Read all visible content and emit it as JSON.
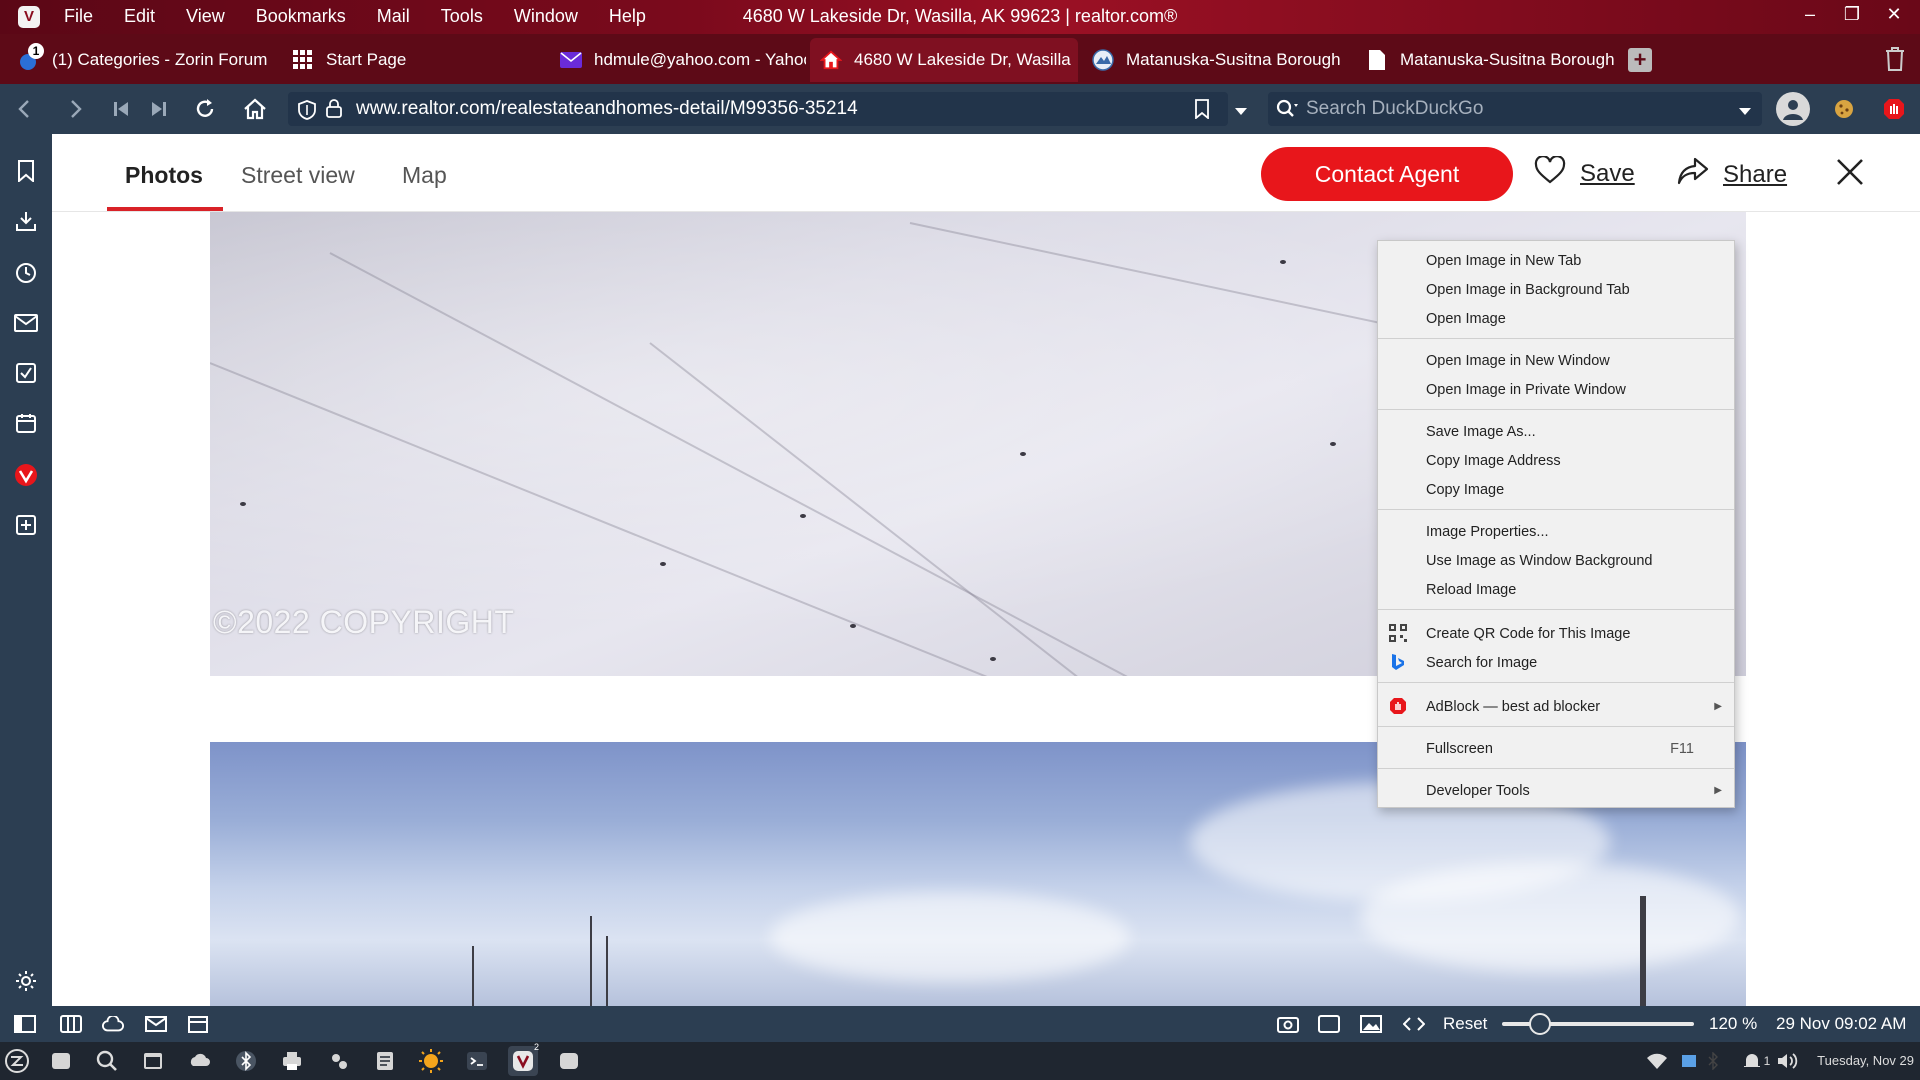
{
  "titlebar": {
    "menu": [
      "File",
      "Edit",
      "View",
      "Bookmarks",
      "Mail",
      "Tools",
      "Window",
      "Help"
    ],
    "window_title": "4680 W Lakeside Dr, Wasilla, AK 99623 | realtor.com®"
  },
  "tabs": [
    {
      "label": "(1) Categories - Zorin Forum",
      "badge": "1",
      "icon": "zorin-forum-icon"
    },
    {
      "label": "Start Page",
      "icon": "grid-icon"
    },
    {
      "label": "hdmule@yahoo.com - Yahoo",
      "icon": "mail-icon"
    },
    {
      "label": "4680 W Lakeside Dr, Wasilla",
      "icon": "realtor-house-icon",
      "active": true
    },
    {
      "label": "Matanuska-Susitna Borough",
      "icon": "borough-seal-icon"
    },
    {
      "label": "Matanuska-Susitna Borough",
      "icon": "document-icon"
    }
  ],
  "addressbar": {
    "url": "www.realtor.com/realestateandhomes-detail/M99356-35214",
    "search_placeholder": "Search DuckDuckGo"
  },
  "page": {
    "tabs": [
      "Photos",
      "Street view",
      "Map"
    ],
    "active_tab": "Photos",
    "contact_label": "Contact Agent",
    "save_label": "Save",
    "share_label": "Share",
    "copyright": "©2022 COPYRIGHT"
  },
  "context_menu": {
    "groups": [
      [
        "Open Image in New Tab",
        "Open Image in Background Tab",
        "Open Image"
      ],
      [
        "Open Image in New Window",
        "Open Image in Private Window"
      ],
      [
        "Save Image As...",
        "Copy Image Address",
        "Copy Image"
      ],
      [
        "Image Properties...",
        "Use Image as Window Background",
        "Reload Image"
      ],
      [
        "Create QR Code for This Image",
        "Search for Image"
      ],
      [
        "AdBlock — best ad blocker"
      ],
      [
        "Fullscreen"
      ],
      [
        "Developer Tools"
      ]
    ],
    "fullscreen_shortcut": "F11"
  },
  "statusbar": {
    "reset_label": "Reset",
    "zoom": "120 %",
    "zoom_fraction": 0.2,
    "clock": "29 Nov  09:02 AM"
  },
  "taskbar": {
    "date": "Tuesday, Nov 29",
    "notifications": "1",
    "vivaldi_windows": "2"
  },
  "colors": {
    "brand_red": "#e8161b",
    "chrome_dark": "#2c3e52",
    "titlebar": "#7a0a1c"
  }
}
